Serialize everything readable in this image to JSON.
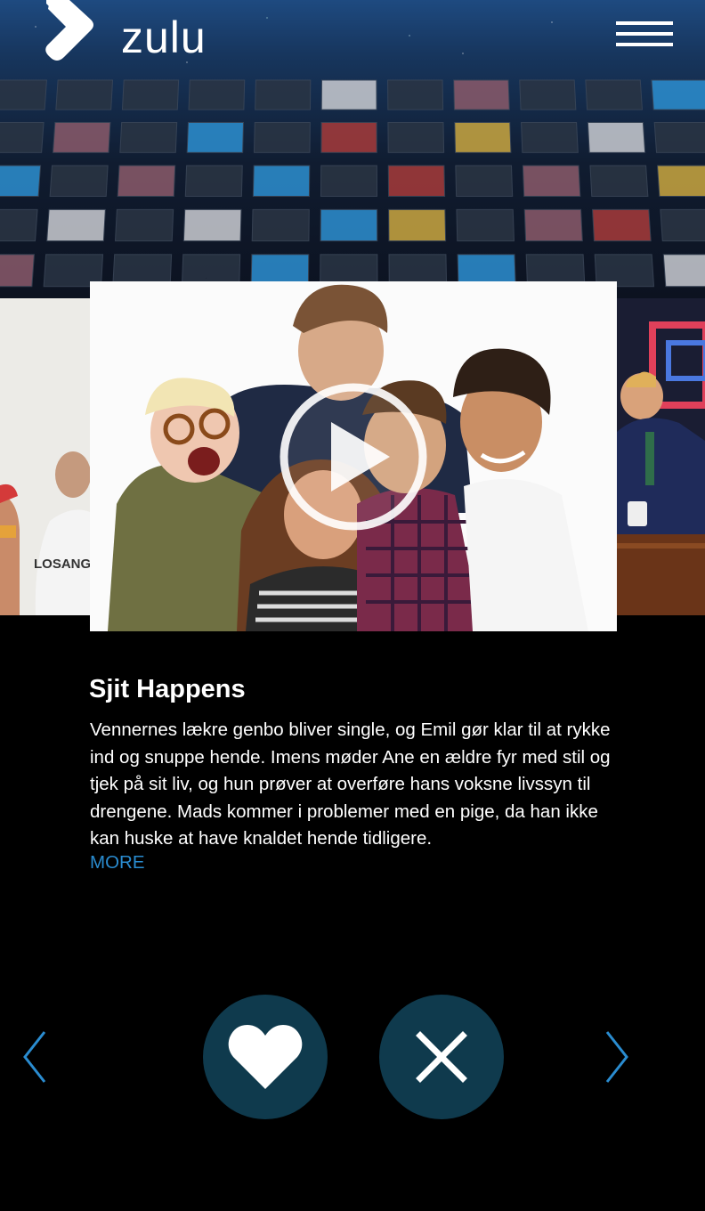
{
  "header": {
    "logo_text": "zulu",
    "logo_icon": "zulu-chevron-logo",
    "menu_icon": "hamburger-menu-icon"
  },
  "carousel": {
    "current": {
      "title": "Sjit Happens",
      "description": "Vennernes lækre genbo bliver single, og Emil gør klar til at rykke ind og snuppe hende. Imens møder Ane en ældre fyr med stil og tjek på sit liv, og hun prøver at overføre hans voksne livssyn til drengene. Mads kommer i problemer med en pige, da han ikke kan huske at have knaldet hende tidligere.",
      "more_label": "MORE",
      "play_icon": "play-icon"
    }
  },
  "controls": {
    "prev_icon": "chevron-left-icon",
    "next_icon": "chevron-right-icon",
    "like_icon": "heart-icon",
    "dismiss_icon": "close-icon"
  },
  "colors": {
    "background": "#000000",
    "accent_link": "#2a8cd0",
    "button_bg": "#0f3a4d",
    "arrow": "#2a8cd0"
  }
}
